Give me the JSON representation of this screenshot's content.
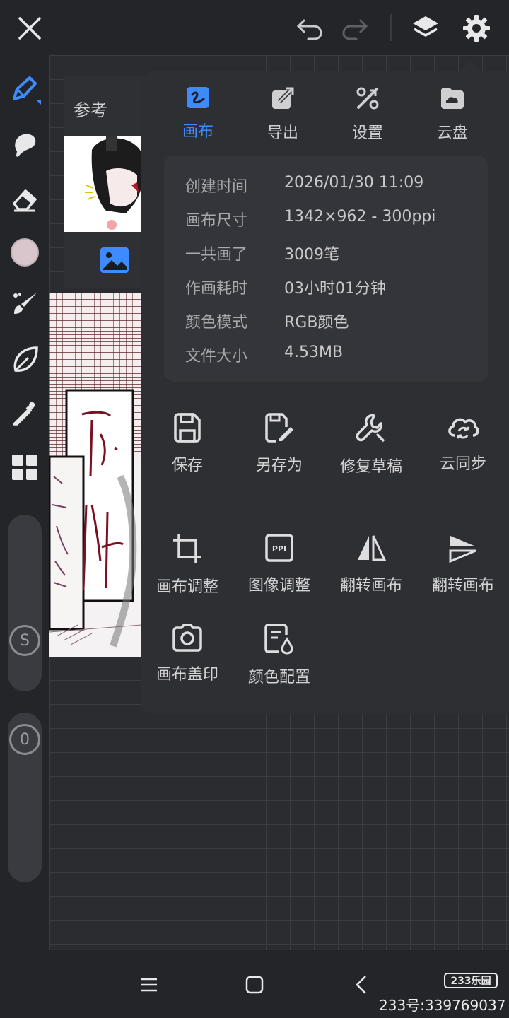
{
  "reference": {
    "title": "参考"
  },
  "popup": {
    "tabs": [
      {
        "label": "画布",
        "icon": "canvas-icon",
        "active": true
      },
      {
        "label": "导出",
        "icon": "export-icon",
        "active": false
      },
      {
        "label": "设置",
        "icon": "settings-tools-icon",
        "active": false
      },
      {
        "label": "云盘",
        "icon": "cloud-drive-icon",
        "active": false
      }
    ],
    "info": [
      {
        "key": "创建时间",
        "value": "2026/01/30 11:09"
      },
      {
        "key": "画布尺寸",
        "value": "1342×962 - 300ppi"
      },
      {
        "key": "一共画了",
        "value": "3009笔"
      },
      {
        "key": "作画耗时",
        "value": "03小时01分钟"
      },
      {
        "key": "颜色模式",
        "value": "RGB颜色"
      },
      {
        "key": "文件大小",
        "value": "4.53MB"
      }
    ],
    "primary_actions": [
      {
        "label": "保存",
        "icon": "save-icon"
      },
      {
        "label": "另存为",
        "icon": "save-as-icon"
      },
      {
        "label": "修复草稿",
        "icon": "repair-icon"
      },
      {
        "label": "云同步",
        "icon": "cloud-sync-icon"
      }
    ],
    "secondary_actions": [
      {
        "label": "画布调整",
        "icon": "crop-icon"
      },
      {
        "label": "图像调整",
        "icon": "ppi-icon"
      },
      {
        "label": "翻转画布",
        "icon": "flip-horizontal-icon"
      },
      {
        "label": "翻转画布",
        "icon": "flip-vertical-icon"
      },
      {
        "label": "画布盖印",
        "icon": "camera-icon"
      },
      {
        "label": "颜色配置",
        "icon": "color-config-icon"
      }
    ]
  },
  "sliders": {
    "size_label": "S",
    "opacity_label": "0"
  },
  "colors": {
    "accent": "#3d8bff",
    "current_color": "#d8c6cc"
  },
  "watermark": {
    "logo": "233乐园",
    "id": "233号:339769037"
  }
}
